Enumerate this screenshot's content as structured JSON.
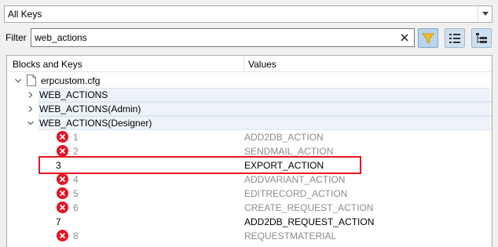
{
  "top_combo": {
    "value": "All Keys",
    "icon": "chevron-down-icon"
  },
  "filter": {
    "label": "Filter",
    "value": "web_actions",
    "clear_icon": "close-icon"
  },
  "toolbar": [
    {
      "name": "filter-toggle",
      "icon": "funnel-icon"
    },
    {
      "name": "list-view",
      "icon": "list-icon"
    },
    {
      "name": "tree-view",
      "icon": "tree-icon"
    }
  ],
  "columns": {
    "keys": "Blocks and Keys",
    "values": "Values"
  },
  "tree": {
    "file": "erpcustom.cfg",
    "blocks": [
      {
        "label": "WEB_ACTIONS",
        "expanded": false
      },
      {
        "label": "WEB_ACTIONS(Admin)",
        "expanded": false
      },
      {
        "label": "WEB_ACTIONS(Designer)",
        "expanded": true
      }
    ],
    "rows": [
      {
        "key": "1",
        "value": "ADD2DB_ACTION",
        "disabled": true
      },
      {
        "key": "2",
        "value": "SENDMAIL_ACTION",
        "disabled": true
      },
      {
        "key": "3",
        "value": "EXPORT_ACTION",
        "disabled": false
      },
      {
        "key": "4",
        "value": "ADDVARIANT_ACTION",
        "disabled": true
      },
      {
        "key": "5",
        "value": "EDITRECORD_ACTION",
        "disabled": true
      },
      {
        "key": "6",
        "value": "CREATE_REQUEST_ACTION",
        "disabled": true
      },
      {
        "key": "7",
        "value": "ADD2DB_REQUEST_ACTION",
        "disabled": false
      },
      {
        "key": "8",
        "value": "REQUESTMATERIAL",
        "disabled": true
      }
    ]
  },
  "colors": {
    "error": "#e81123",
    "highlight": "#e8141d",
    "disabled_text": "#8c8c8c"
  }
}
